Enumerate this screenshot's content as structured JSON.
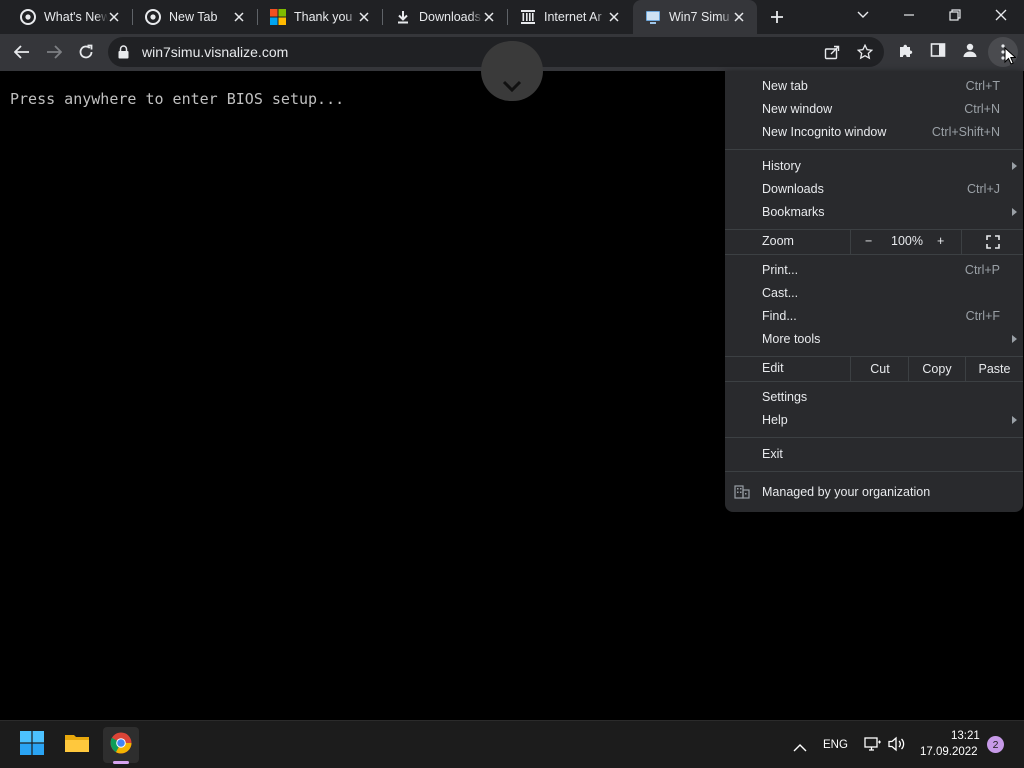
{
  "tabs": [
    {
      "title": "What's New",
      "favicon": "chrome-icon"
    },
    {
      "title": "New Tab",
      "favicon": "chrome-icon"
    },
    {
      "title": "Thank you",
      "favicon": "microsoft-icon"
    },
    {
      "title": "Downloads",
      "favicon": "download-icon"
    },
    {
      "title": "Internet Ar",
      "favicon": "archive-icon"
    },
    {
      "title": "Win7 Simu",
      "favicon": "win7-icon"
    }
  ],
  "toolbar": {
    "url": "win7simu.visnalize.com"
  },
  "page": {
    "bios_text": "Press anywhere to enter BIOS setup..."
  },
  "menu": {
    "new_tab": {
      "label": "New tab",
      "shortcut": "Ctrl+T"
    },
    "new_window": {
      "label": "New window",
      "shortcut": "Ctrl+N"
    },
    "new_incognito": {
      "label": "New Incognito window",
      "shortcut": "Ctrl+Shift+N"
    },
    "history": {
      "label": "History"
    },
    "downloads": {
      "label": "Downloads",
      "shortcut": "Ctrl+J"
    },
    "bookmarks": {
      "label": "Bookmarks"
    },
    "zoom": {
      "label": "Zoom",
      "minus": "−",
      "value": "100%",
      "plus": "+"
    },
    "print": {
      "label": "Print...",
      "shortcut": "Ctrl+P"
    },
    "cast": {
      "label": "Cast..."
    },
    "find": {
      "label": "Find...",
      "shortcut": "Ctrl+F"
    },
    "more_tools": {
      "label": "More tools"
    },
    "edit": {
      "label": "Edit",
      "cut": "Cut",
      "copy": "Copy",
      "paste": "Paste"
    },
    "settings": {
      "label": "Settings"
    },
    "help": {
      "label": "Help"
    },
    "exit": {
      "label": "Exit"
    },
    "managed": {
      "label": "Managed by your organization"
    }
  },
  "taskbar": {
    "lang": "ENG",
    "time": "13:21",
    "date": "17.09.2022",
    "notifications": "2"
  },
  "colors": {
    "accent": "#8ab4f8",
    "tabstrip": "#202124",
    "toolbar": "#35363a",
    "menu": "#292a2d"
  }
}
